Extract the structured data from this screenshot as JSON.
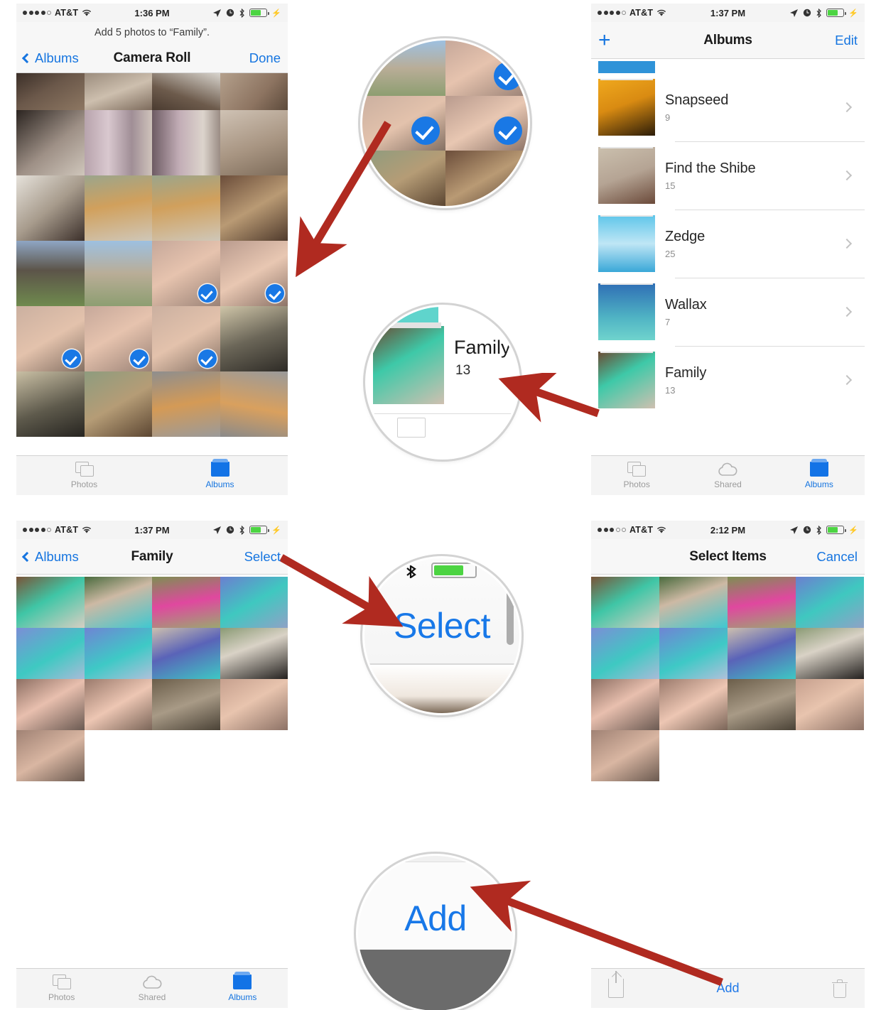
{
  "panels": {
    "camera_roll": {
      "status": {
        "carrier": "AT&T",
        "time": "1:36 PM",
        "signal_filled": 4,
        "signal_total": 5
      },
      "prompt": "Add 5 photos to “Family”.",
      "nav": {
        "back": "Albums",
        "title": "Camera Roll",
        "action": "Done"
      },
      "tabs": [
        {
          "label": "Photos",
          "icon": "photos-icon",
          "active": false
        },
        {
          "label": "Albums",
          "icon": "albums-icon",
          "active": true
        }
      ]
    },
    "albums": {
      "status": {
        "carrier": "AT&T",
        "time": "1:37 PM",
        "signal_filled": 4,
        "signal_total": 5
      },
      "nav": {
        "add": "+",
        "title": "Albums",
        "action": "Edit"
      },
      "items": [
        {
          "name": "Snapseed",
          "count": "9",
          "art": "p-snapseed"
        },
        {
          "name": "Find the Shibe",
          "count": "15",
          "art": "p-shibe"
        },
        {
          "name": "Zedge",
          "count": "25",
          "art": "p-zedge"
        },
        {
          "name": "Wallax",
          "count": "7",
          "art": "p-wallax"
        },
        {
          "name": "Family",
          "count": "13",
          "art": "p-fam-mom"
        }
      ],
      "tabs": [
        {
          "label": "Photos",
          "icon": "photos-icon",
          "active": false
        },
        {
          "label": "Shared",
          "icon": "cloud-icon",
          "active": false
        },
        {
          "label": "Albums",
          "icon": "albums-icon",
          "active": true
        }
      ]
    },
    "family_album": {
      "status": {
        "carrier": "AT&T",
        "time": "1:37 PM",
        "signal_filled": 4,
        "signal_total": 5
      },
      "nav": {
        "back": "Albums",
        "title": "Family",
        "action": "Select"
      },
      "tabs": [
        {
          "label": "Photos",
          "icon": "photos-icon",
          "active": false
        },
        {
          "label": "Shared",
          "icon": "cloud-icon",
          "active": false
        },
        {
          "label": "Albums",
          "icon": "albums-icon",
          "active": true
        }
      ]
    },
    "select_items": {
      "status": {
        "carrier": "AT&T",
        "time": "2:12 PM",
        "signal_filled": 3,
        "signal_total": 5
      },
      "nav": {
        "title": "Select Items",
        "action": "Cancel"
      },
      "toolbar": {
        "share": "share-icon",
        "add": "Add",
        "trash": "trash-icon"
      }
    }
  },
  "callouts": {
    "checkmarks": {
      "label": "selected-photo-checkmarks"
    },
    "family_album": {
      "name": "Family",
      "count": "13"
    },
    "select": {
      "label": "Select"
    },
    "add": {
      "label": "Add"
    }
  },
  "colors": {
    "accent": "#1675e0",
    "check": "#1978e5",
    "arrow": "#b02a20",
    "battery": "#4cd442"
  }
}
